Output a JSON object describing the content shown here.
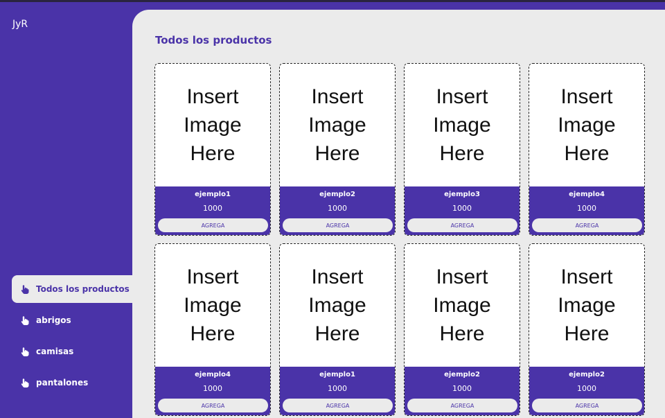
{
  "app": {
    "logo": "JyR"
  },
  "sidebar": {
    "items": [
      {
        "label": "Todos los productos",
        "icon": "hand-pointer-icon",
        "active": true
      },
      {
        "label": "abrigos",
        "icon": "hand-pointer-icon",
        "active": false
      },
      {
        "label": "camisas",
        "icon": "hand-pointer-icon",
        "active": false
      },
      {
        "label": "pantalones",
        "icon": "hand-pointer-icon",
        "active": false
      }
    ]
  },
  "main": {
    "title": "Todos los productos",
    "image_placeholder": "Insert\nImage\nHere",
    "products": [
      {
        "name": "ejemplo1",
        "price": "1000",
        "button": "AGREGA"
      },
      {
        "name": "ejemplo2",
        "price": "1000",
        "button": "AGREGA"
      },
      {
        "name": "ejemplo3",
        "price": "1000",
        "button": "AGREGA"
      },
      {
        "name": "ejemplo4",
        "price": "1000",
        "button": "AGREGA"
      },
      {
        "name": "ejemplo4",
        "price": "1000",
        "button": "AGREGA"
      },
      {
        "name": "ejemplo1",
        "price": "1000",
        "button": "AGREGA"
      },
      {
        "name": "ejemplo2",
        "price": "1000",
        "button": "AGREGA"
      },
      {
        "name": "ejemplo2",
        "price": "1000",
        "button": "AGREGA"
      }
    ]
  },
  "colors": {
    "accent": "#4a33a8",
    "surface": "#ebebeb"
  }
}
